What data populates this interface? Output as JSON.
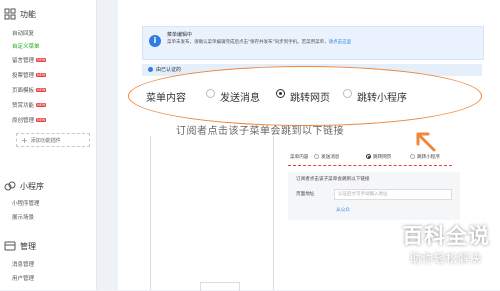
{
  "sidebar": {
    "features": {
      "title": "功能",
      "items": [
        {
          "label": "自动回复",
          "badge": "",
          "active": false
        },
        {
          "label": "自定义菜单",
          "badge": "",
          "active": true
        },
        {
          "label": "留言管理",
          "badge": "NEW",
          "active": false
        },
        {
          "label": "投票管理",
          "badge": "NEW",
          "active": false
        },
        {
          "label": "页面模板",
          "badge": "NEW",
          "active": false
        },
        {
          "label": "赞赏功能",
          "badge": "NEW",
          "active": false
        },
        {
          "label": "原创管理",
          "badge": "NEW",
          "active": false
        }
      ],
      "add_plugin": "添加功能插件"
    },
    "miniprogram": {
      "title": "小程序",
      "items": [
        {
          "label": "小程序管理"
        },
        {
          "label": "展示场景"
        }
      ]
    },
    "manage": {
      "title": "管理",
      "items": [
        {
          "label": "消息管理"
        },
        {
          "label": "用户管理"
        }
      ]
    }
  },
  "notice": {
    "title": "菜单编辑中",
    "body_pre": "菜单未发布，请确认菜单编辑完成后点击\"保存并发布\"同步到手机。若菜用菜单，",
    "body_link": "请点击这里"
  },
  "section_bar": {
    "text": "由已认证的"
  },
  "zoom": {
    "label": "菜单内容",
    "options": [
      {
        "label": "发送消息",
        "selected": false
      },
      {
        "label": "跳转网页",
        "selected": true
      },
      {
        "label": "跳转小程序",
        "selected": false
      }
    ],
    "link_text": "订阅者点击该子菜单会跳到以下链接"
  },
  "panel": {
    "label": "菜单内容",
    "options": [
      {
        "label": "发送消息",
        "selected": false
      },
      {
        "label": "跳转网页",
        "selected": true
      },
      {
        "label": "跳转小程序",
        "selected": false
      }
    ],
    "desc": "订阅者点击该子菜单会跳到以下链接",
    "url_label": "页面地址",
    "url_placeholder": "认证后才可手动输入地址",
    "from": "从公众"
  },
  "watermark": {
    "title": "百科全说",
    "subtitle": "助你轻松解决"
  },
  "colors": {
    "accent": "#1aad19",
    "highlight": "#f0863a",
    "info": "#2e7de3",
    "badge": "#e64340"
  }
}
